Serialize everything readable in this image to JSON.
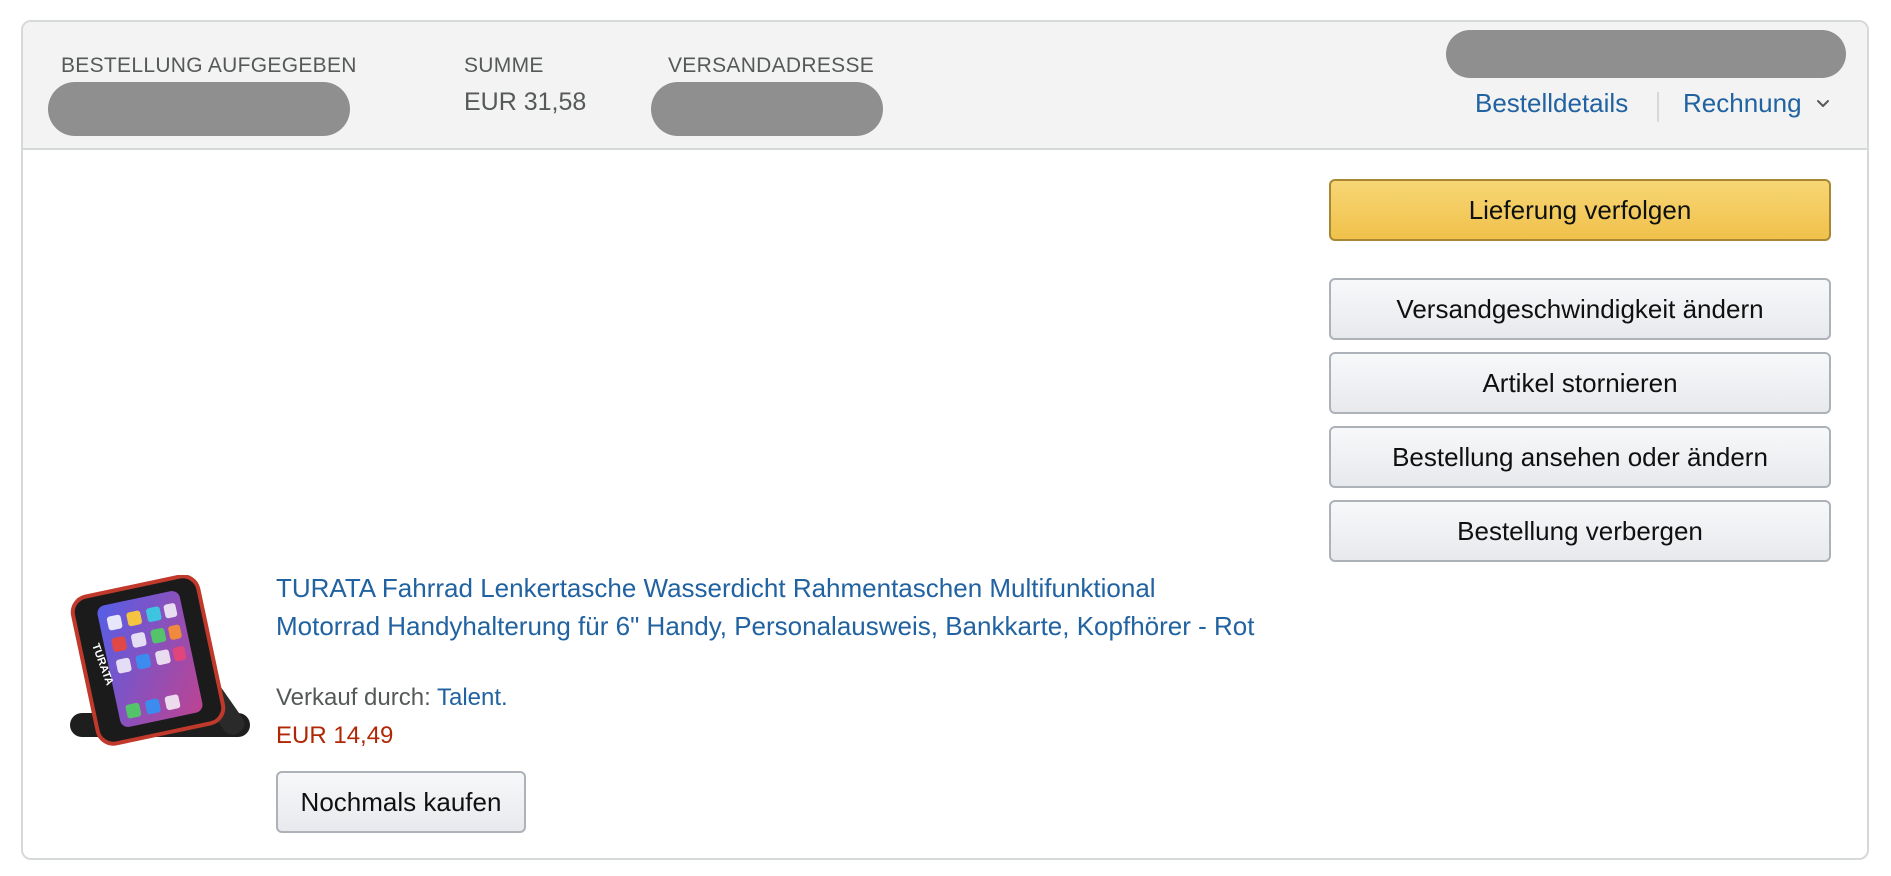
{
  "header": {
    "order_placed_label": "BESTELLUNG AUFGEGEBEN",
    "total_label": "SUMME",
    "total_value": "EUR 31,58",
    "ship_to_label": "VERSANDADRESSE",
    "order_details_link": "Bestelldetails",
    "invoice_link": "Rechnung"
  },
  "actions": {
    "track_package": "Lieferung verfolgen",
    "change_shipping_speed": "Versandgeschwindigkeit ändern",
    "cancel_items": "Artikel stornieren",
    "view_or_edit_order": "Bestellung ansehen oder ändern",
    "archive_order": "Bestellung verbergen"
  },
  "item": {
    "title": "TURATA Fahrrad Lenkertasche Wasserdicht Rahmentaschen Multifunktional Motorrad Handyhalterung für 6\" Handy, Personalausweis, Bankkarte, Kopfhörer - Rot",
    "sold_by_label": "Verkauf durch: ",
    "seller": "Talent.",
    "price": "EUR 14,49",
    "buy_again": "Nochmals kaufen",
    "image_brand_text": "TURATA"
  },
  "colors": {
    "link": "#2162a1",
    "price": "#b12704",
    "primary_button": "#f0c14b",
    "header_bg": "#f3f3f3",
    "redaction": "#8f8f8f"
  },
  "icons": {
    "invoice_dropdown": "chevron-down-icon"
  }
}
